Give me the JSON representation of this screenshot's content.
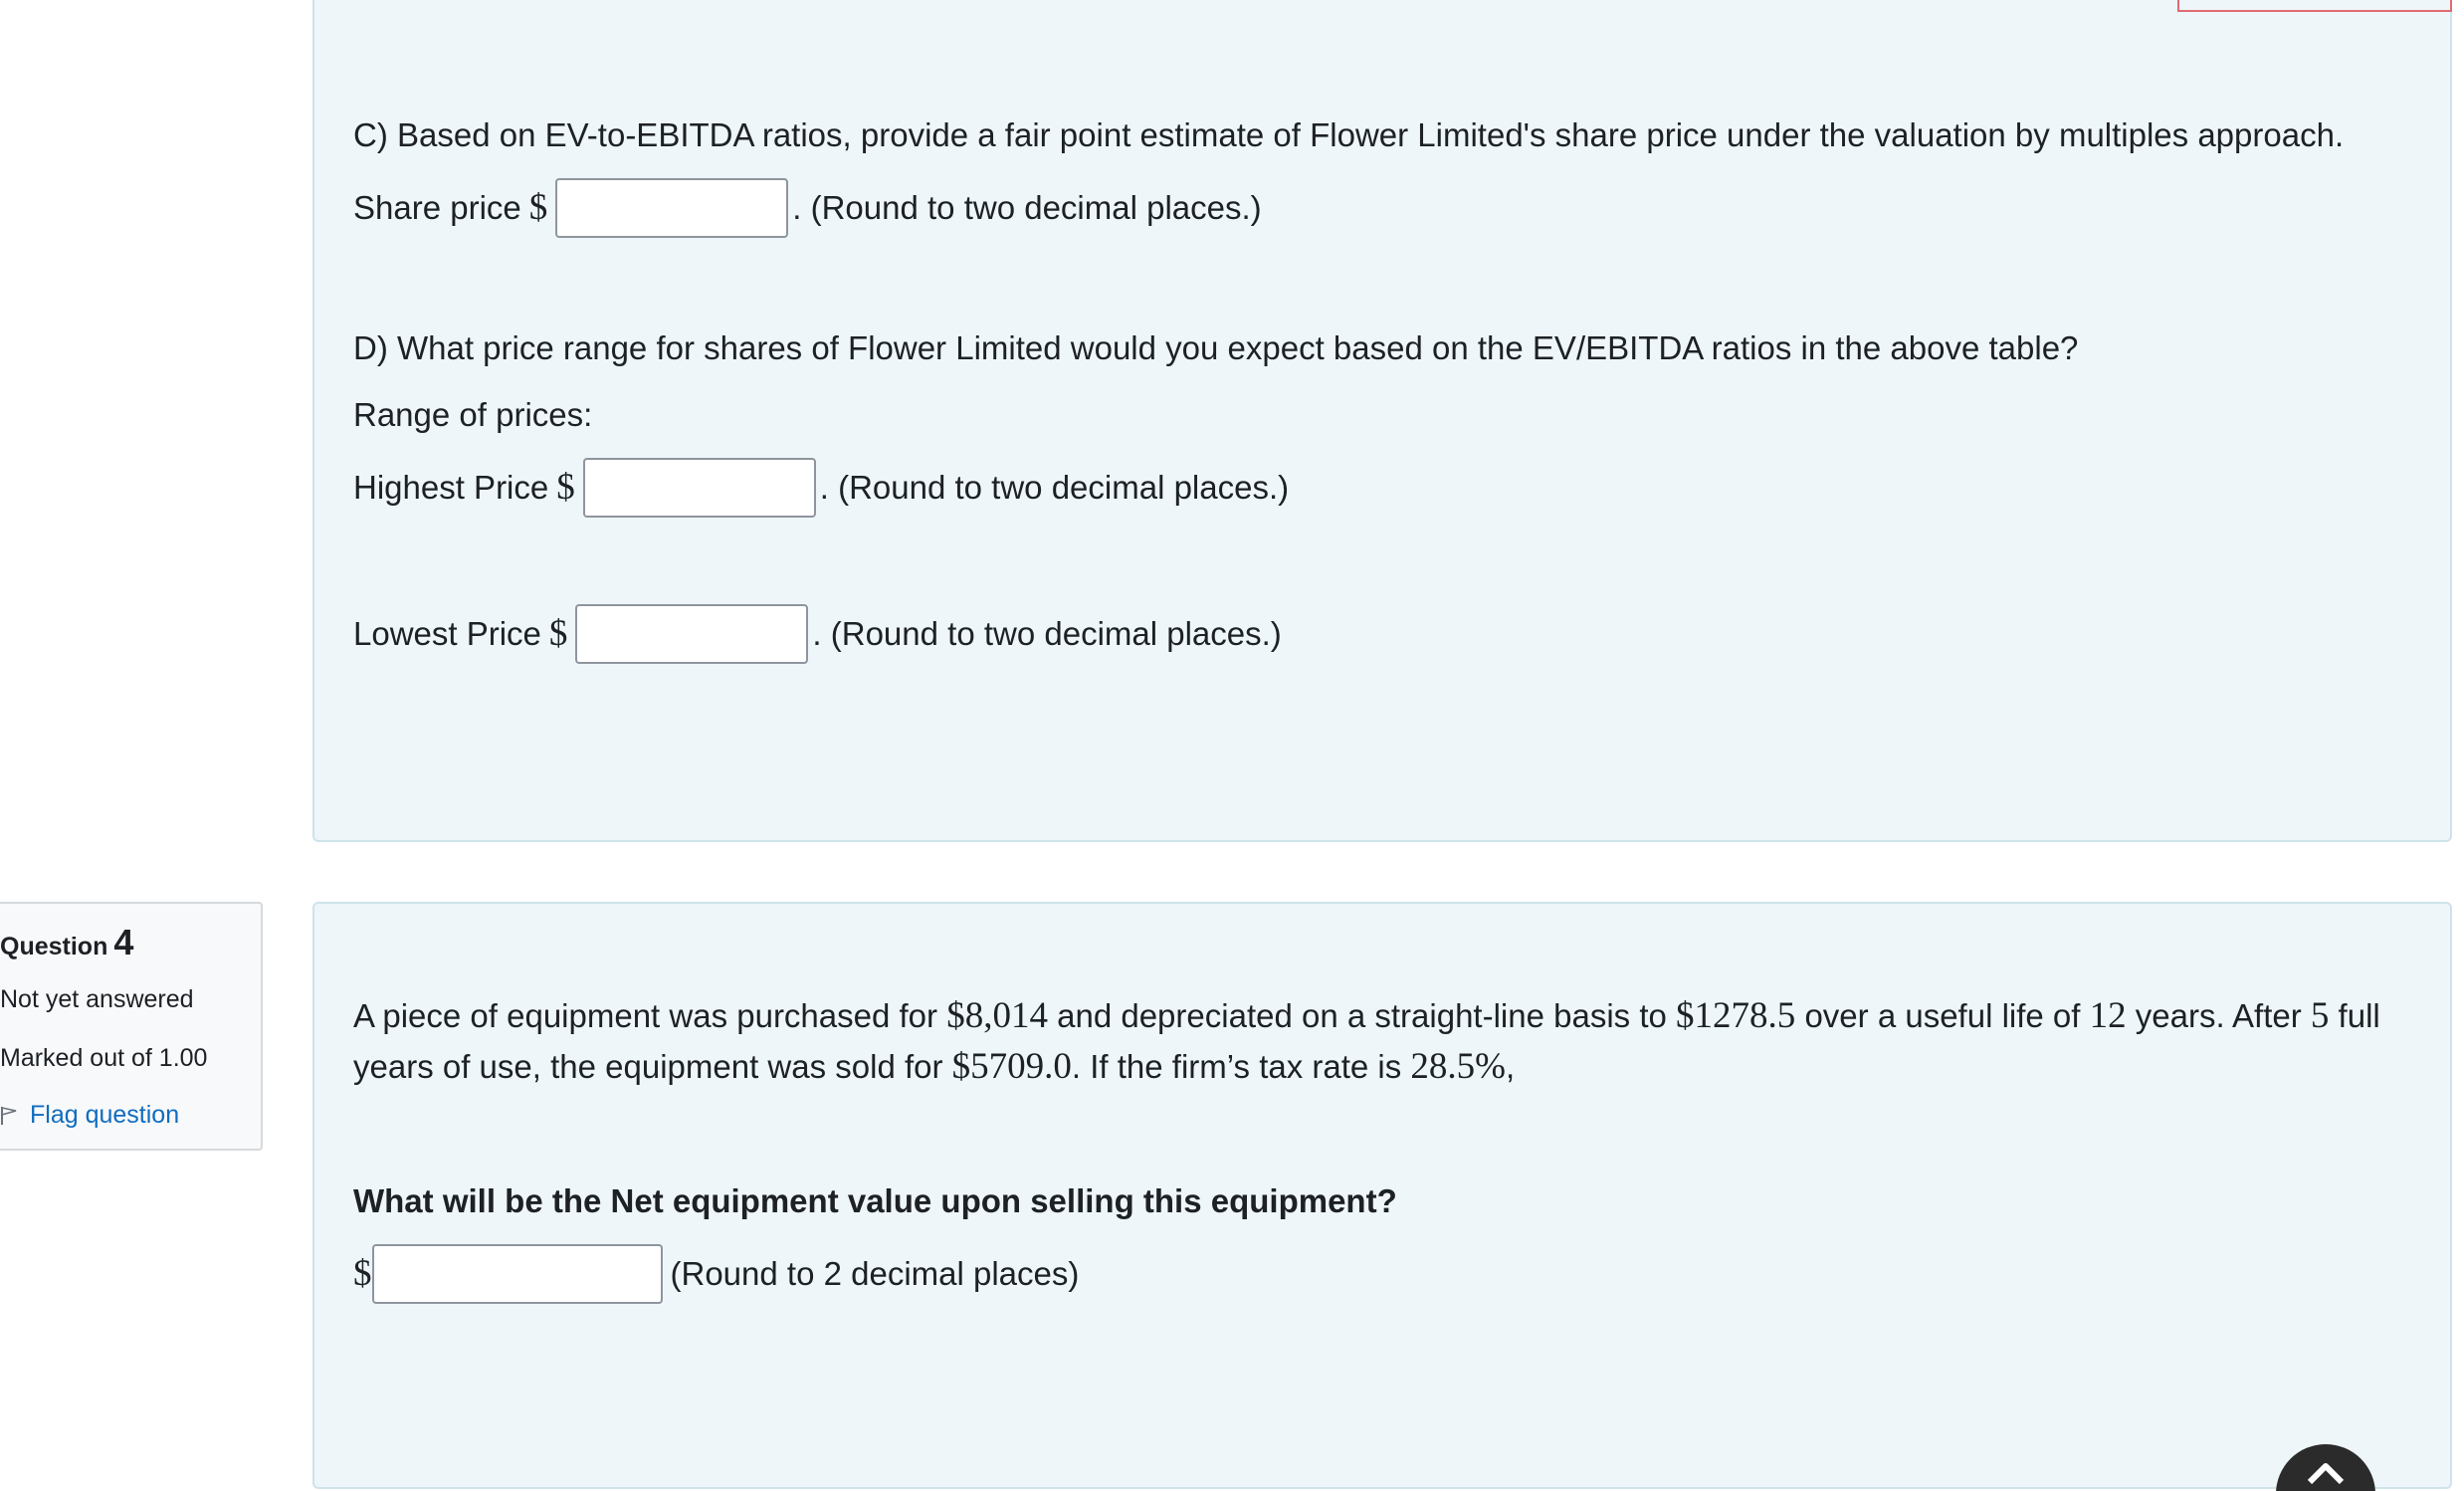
{
  "partC": {
    "question": "C) Based on EV-to-EBITDA ratios, provide a fair point estimate of Flower Limited's share price under the valuation by multiples approach.",
    "label": "Share price",
    "currency": "$",
    "input_value": "",
    "hint": ". (Round to two decimal places.)"
  },
  "partD": {
    "question": "D) What price range for shares of Flower Limited would you expect based on the EV/EBITDA ratios in the above table?",
    "range_label": "Range of prices:",
    "highest": {
      "label": "Highest Price",
      "currency": "$",
      "input_value": "",
      "hint": ". (Round to two decimal places.)"
    },
    "lowest": {
      "label": "Lowest Price",
      "currency": "$",
      "input_value": "",
      "hint": ". (Round to two decimal places.)"
    }
  },
  "question4_info": {
    "label": "Question",
    "number": "4",
    "status": "Not yet answered",
    "marked": "Marked out of 1.00",
    "flag": "Flag question"
  },
  "question4": {
    "text1_a": "A piece of equipment was purchased for",
    "cost": "$8,014",
    "text1_b": "and depreciated on a straight-line basis to",
    "salvage": "$1278.5",
    "text1_c": "over a useful life of",
    "life": "12",
    "text1_d": "years. After",
    "used": "5",
    "text1_e": "full",
    "text2_a": "years of use, the equipment was sold for",
    "sale": "$5709.0",
    "text2_b": ". If the firm’s tax rate is",
    "tax": "28.5%",
    "text2_c": ",",
    "prompt": "What will be the Net equipment value upon selling this equipment?",
    "currency": "$",
    "input_value": "",
    "hint": "(Round to 2 decimal places)"
  },
  "icons": {
    "flag": "flag-outline-icon",
    "scroll_top": "chevron-up-icon"
  }
}
